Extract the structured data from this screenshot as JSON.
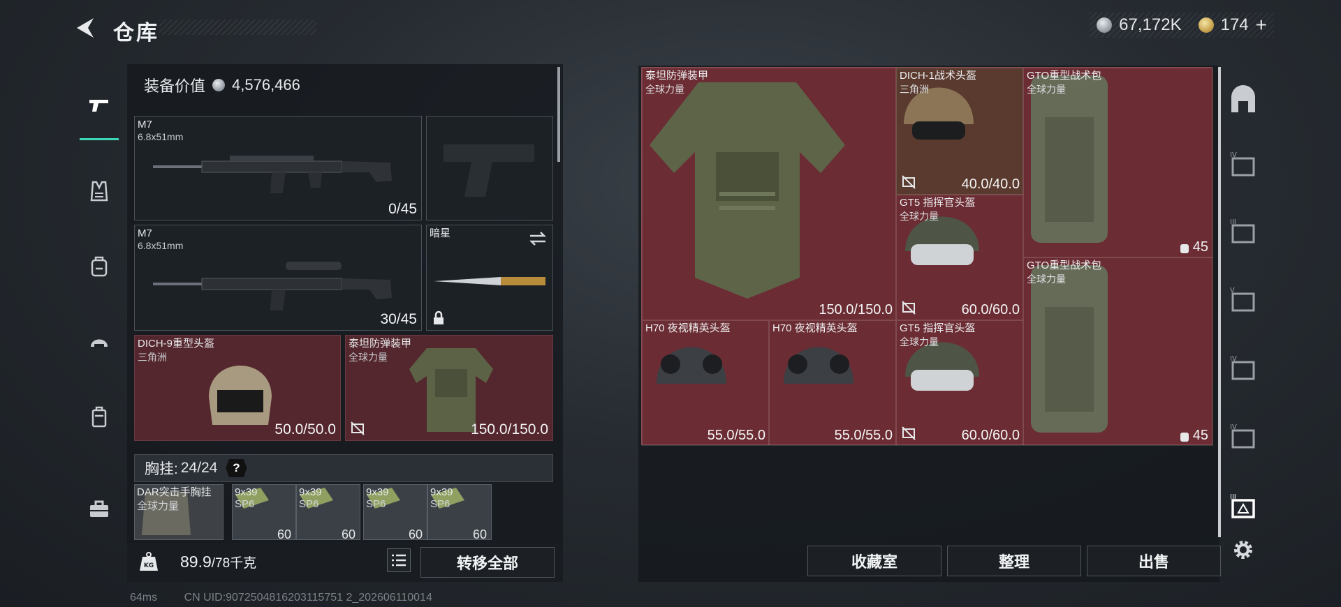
{
  "header": {
    "title": "仓库",
    "silver_amount": "67,172K",
    "gold_amount": "174",
    "gold_plus": "+"
  },
  "loadout": {
    "value_label": "装备价值",
    "value": "4,576,466",
    "primary": {
      "name": "M7",
      "caliber": "6.8x51mm",
      "ammo": "0/45"
    },
    "secondary": {
      "name": "M7",
      "caliber": "6.8x51mm",
      "ammo": "30/45"
    },
    "melee": {
      "name": "暗星"
    },
    "helmet": {
      "name": "DICH-9重型头盔",
      "faction": "三角洲",
      "durability": "50.0/50.0"
    },
    "armor": {
      "name": "泰坦防弹装甲",
      "faction": "全球力量",
      "durability": "150.0/150.0"
    },
    "chest_rig": {
      "label": "胸挂:",
      "count": "24/24",
      "help": "?",
      "item_name": "DAR突击手胸挂",
      "item_faction": "全球力量",
      "slots": [
        {
          "name": "9x39",
          "sub": "SP6",
          "qty": "60"
        },
        {
          "name": "9x39",
          "sub": "SP6",
          "qty": "60"
        },
        {
          "name": "9x39",
          "sub": "SP6",
          "qty": "60"
        },
        {
          "name": "9x39",
          "sub": "SP6",
          "qty": "60"
        }
      ]
    },
    "weight": "89.9",
    "weight_limit": "/78千克",
    "transfer_all": "转移全部"
  },
  "storage": {
    "items": [
      {
        "name": "泰坦防弹装甲",
        "faction": "全球力量",
        "durability": "150.0/150.0"
      },
      {
        "name": "DICH-1战术头盔",
        "faction": "三角洲",
        "durability": "40.0/40.0"
      },
      {
        "name": "GTO重型战术包",
        "faction": "全球力量",
        "capacity": "45"
      },
      {
        "name": "GT5 指挥官头盔",
        "faction": "全球力量",
        "durability": "60.0/60.0"
      },
      {
        "name": "GTO重型战术包",
        "faction": "全球力量",
        "capacity": "45"
      },
      {
        "name": "H70 夜视精英头盔",
        "faction": "",
        "durability": "55.0/55.0"
      },
      {
        "name": "H70 夜视精英头盔",
        "faction": "",
        "durability": "55.0/55.0"
      },
      {
        "name": "GT5 指挥官头盔",
        "faction": "全球力量",
        "durability": "60.0/60.0"
      }
    ],
    "buttons": {
      "collection": "收藏室",
      "sort": "整理",
      "sell": "出售"
    }
  },
  "rail": {
    "tiers": [
      "IV",
      "III",
      "V",
      "IV",
      "IV",
      "III"
    ]
  },
  "footer": {
    "ping": "64ms",
    "uid": "CN UID:9072504816203115751 2_202606110014"
  },
  "colors": {
    "accent": "#3fd6b7",
    "item_bg_red": "#54262d",
    "grid_red": "#6b2c33"
  }
}
